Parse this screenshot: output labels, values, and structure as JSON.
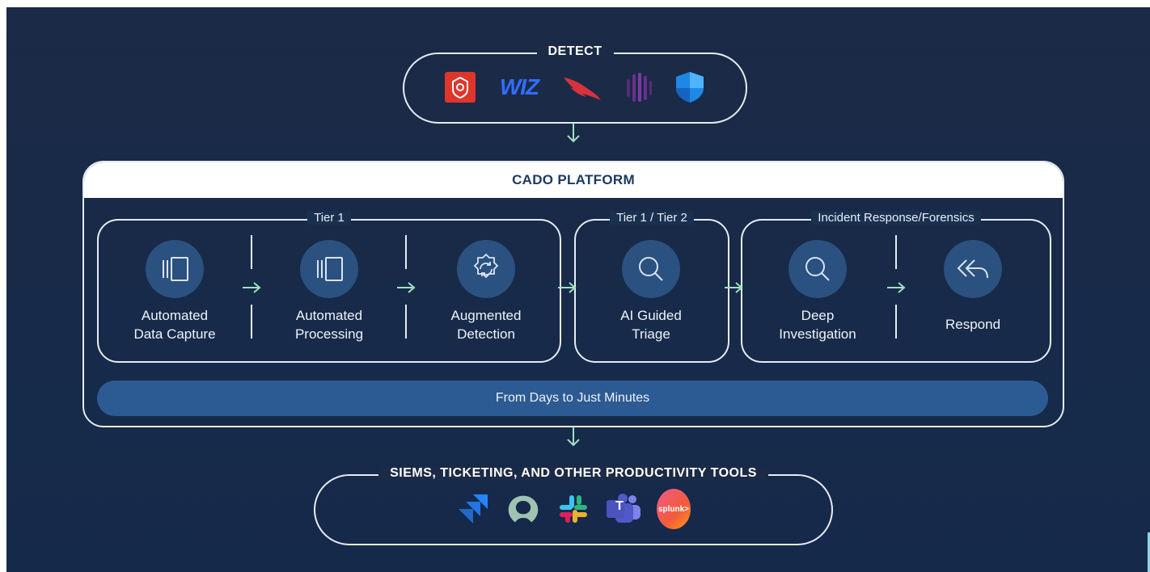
{
  "detect": {
    "title": "DETECT",
    "logos": [
      "aws-security-logo",
      "wiz-logo",
      "crowdstrike-falcon-logo",
      "vectra-logo",
      "microsoft-defender-logo"
    ],
    "wiz_text": "WIZ"
  },
  "platform": {
    "title": "CADO PLATFORM",
    "groups": [
      {
        "label": "Tier 1"
      },
      {
        "label": "Tier 1 / Tier 2"
      },
      {
        "label": "Incident Response/Forensics"
      }
    ],
    "steps": [
      {
        "label": "Automated\nData Capture",
        "icon": "capture-icon"
      },
      {
        "label": "Automated\nProcessing",
        "icon": "processing-icon"
      },
      {
        "label": "Augmented\nDetection",
        "icon": "gear-refresh-icon"
      },
      {
        "label": "AI Guided\nTriage",
        "icon": "magnifier-icon"
      },
      {
        "label": "Deep\nInvestigation",
        "icon": "magnifier-icon"
      },
      {
        "label": "Respond",
        "icon": "reply-all-icon"
      }
    ],
    "banner": "From Days to Just Minutes"
  },
  "output": {
    "title": "SIEMS, TICKETING, AND OTHER PRODUCTIVITY TOOLS",
    "logos": [
      "jira-logo",
      "servicenow-logo",
      "slack-logo",
      "teams-logo",
      "splunk-logo"
    ],
    "teams_text": "T",
    "splunk_text": "splunk>"
  },
  "colors": {
    "background": "#172a49",
    "accent_blue": "#2c5a92",
    "arrow_green": "#9fe0c0",
    "line": "#e6ecf5"
  }
}
